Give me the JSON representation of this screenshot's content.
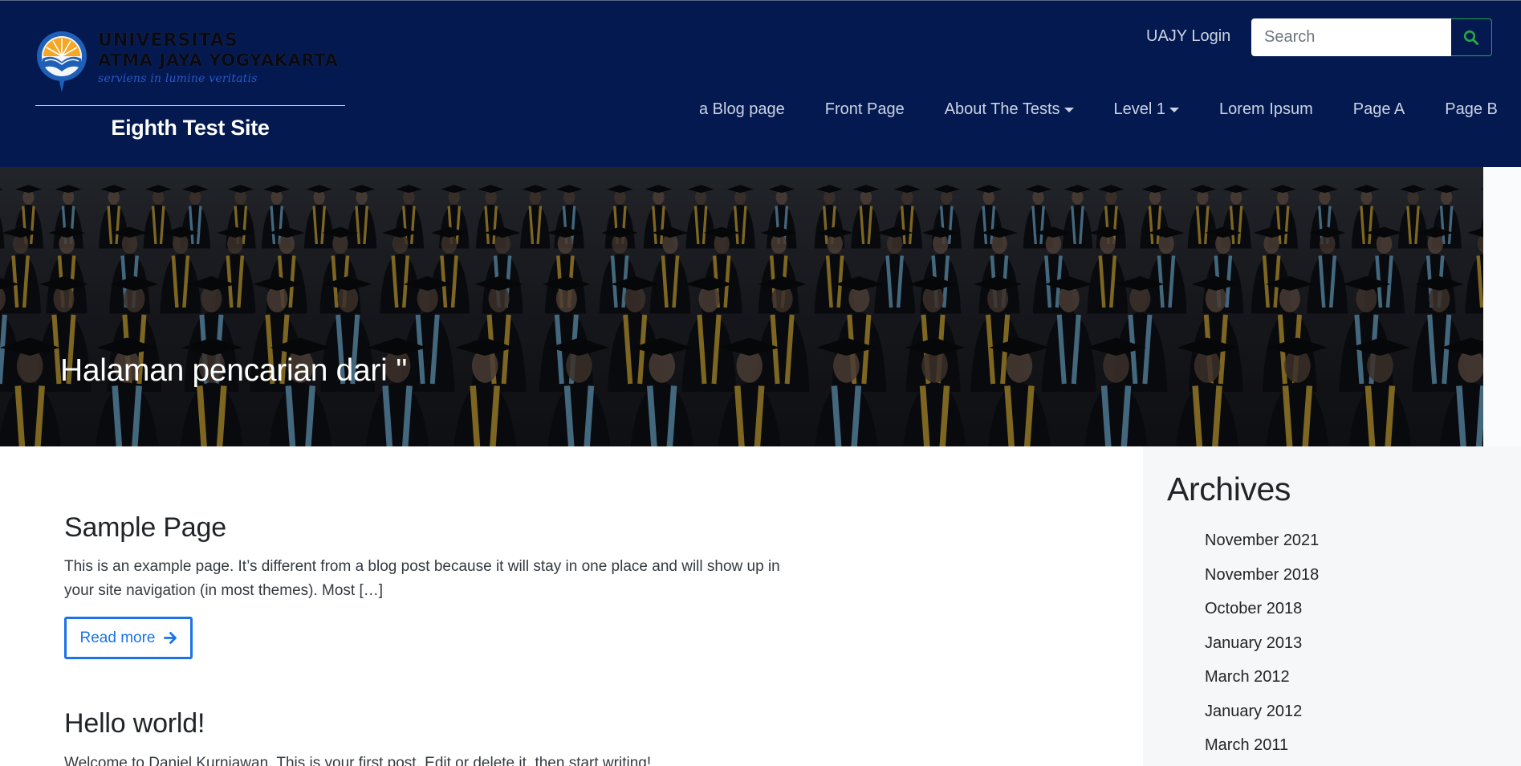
{
  "header": {
    "logo": {
      "line1": "UNIVERSITAS",
      "line2": "ATMA JAYA YOGYAKARTA",
      "tagline": "serviens in lumine veritatis"
    },
    "site_title": "Eighth Test Site",
    "login_label": "UAJY Login",
    "search": {
      "placeholder": "Search",
      "value": ""
    },
    "search_icon": "search-icon",
    "nav": [
      {
        "label": "a Blog page",
        "has_dropdown": false
      },
      {
        "label": "Front Page",
        "has_dropdown": false
      },
      {
        "label": "About The Tests",
        "has_dropdown": true
      },
      {
        "label": "Level 1",
        "has_dropdown": true
      },
      {
        "label": "Lorem Ipsum",
        "has_dropdown": false
      },
      {
        "label": "Page A",
        "has_dropdown": false
      },
      {
        "label": "Page B",
        "has_dropdown": false
      }
    ]
  },
  "hero": {
    "heading": "Halaman pencarian dari ''"
  },
  "posts": [
    {
      "title": "Sample Page",
      "excerpt_line1": "This is an example page. It’s different from a blog post because it will stay in one place and will show up in",
      "excerpt_line2": "your site navigation (in most themes). Most […]",
      "read_more": "Read more"
    },
    {
      "title": "Hello world!",
      "excerpt": "Welcome to Daniel Kurniawan. This is your first post. Edit or delete it, then start writing!"
    }
  ],
  "sidebar": {
    "title": "Archives",
    "archives": [
      "November 2021",
      "November 2018",
      "October 2018",
      "January 2013",
      "March 2012",
      "January 2012",
      "March 2011"
    ]
  },
  "colors": {
    "header_bg": "#03194f",
    "nav_text": "#ccd3e3",
    "accent_blue": "#1a73e8",
    "search_button_border": "#28a745",
    "sidebar_bg": "#f6f7f8"
  }
}
